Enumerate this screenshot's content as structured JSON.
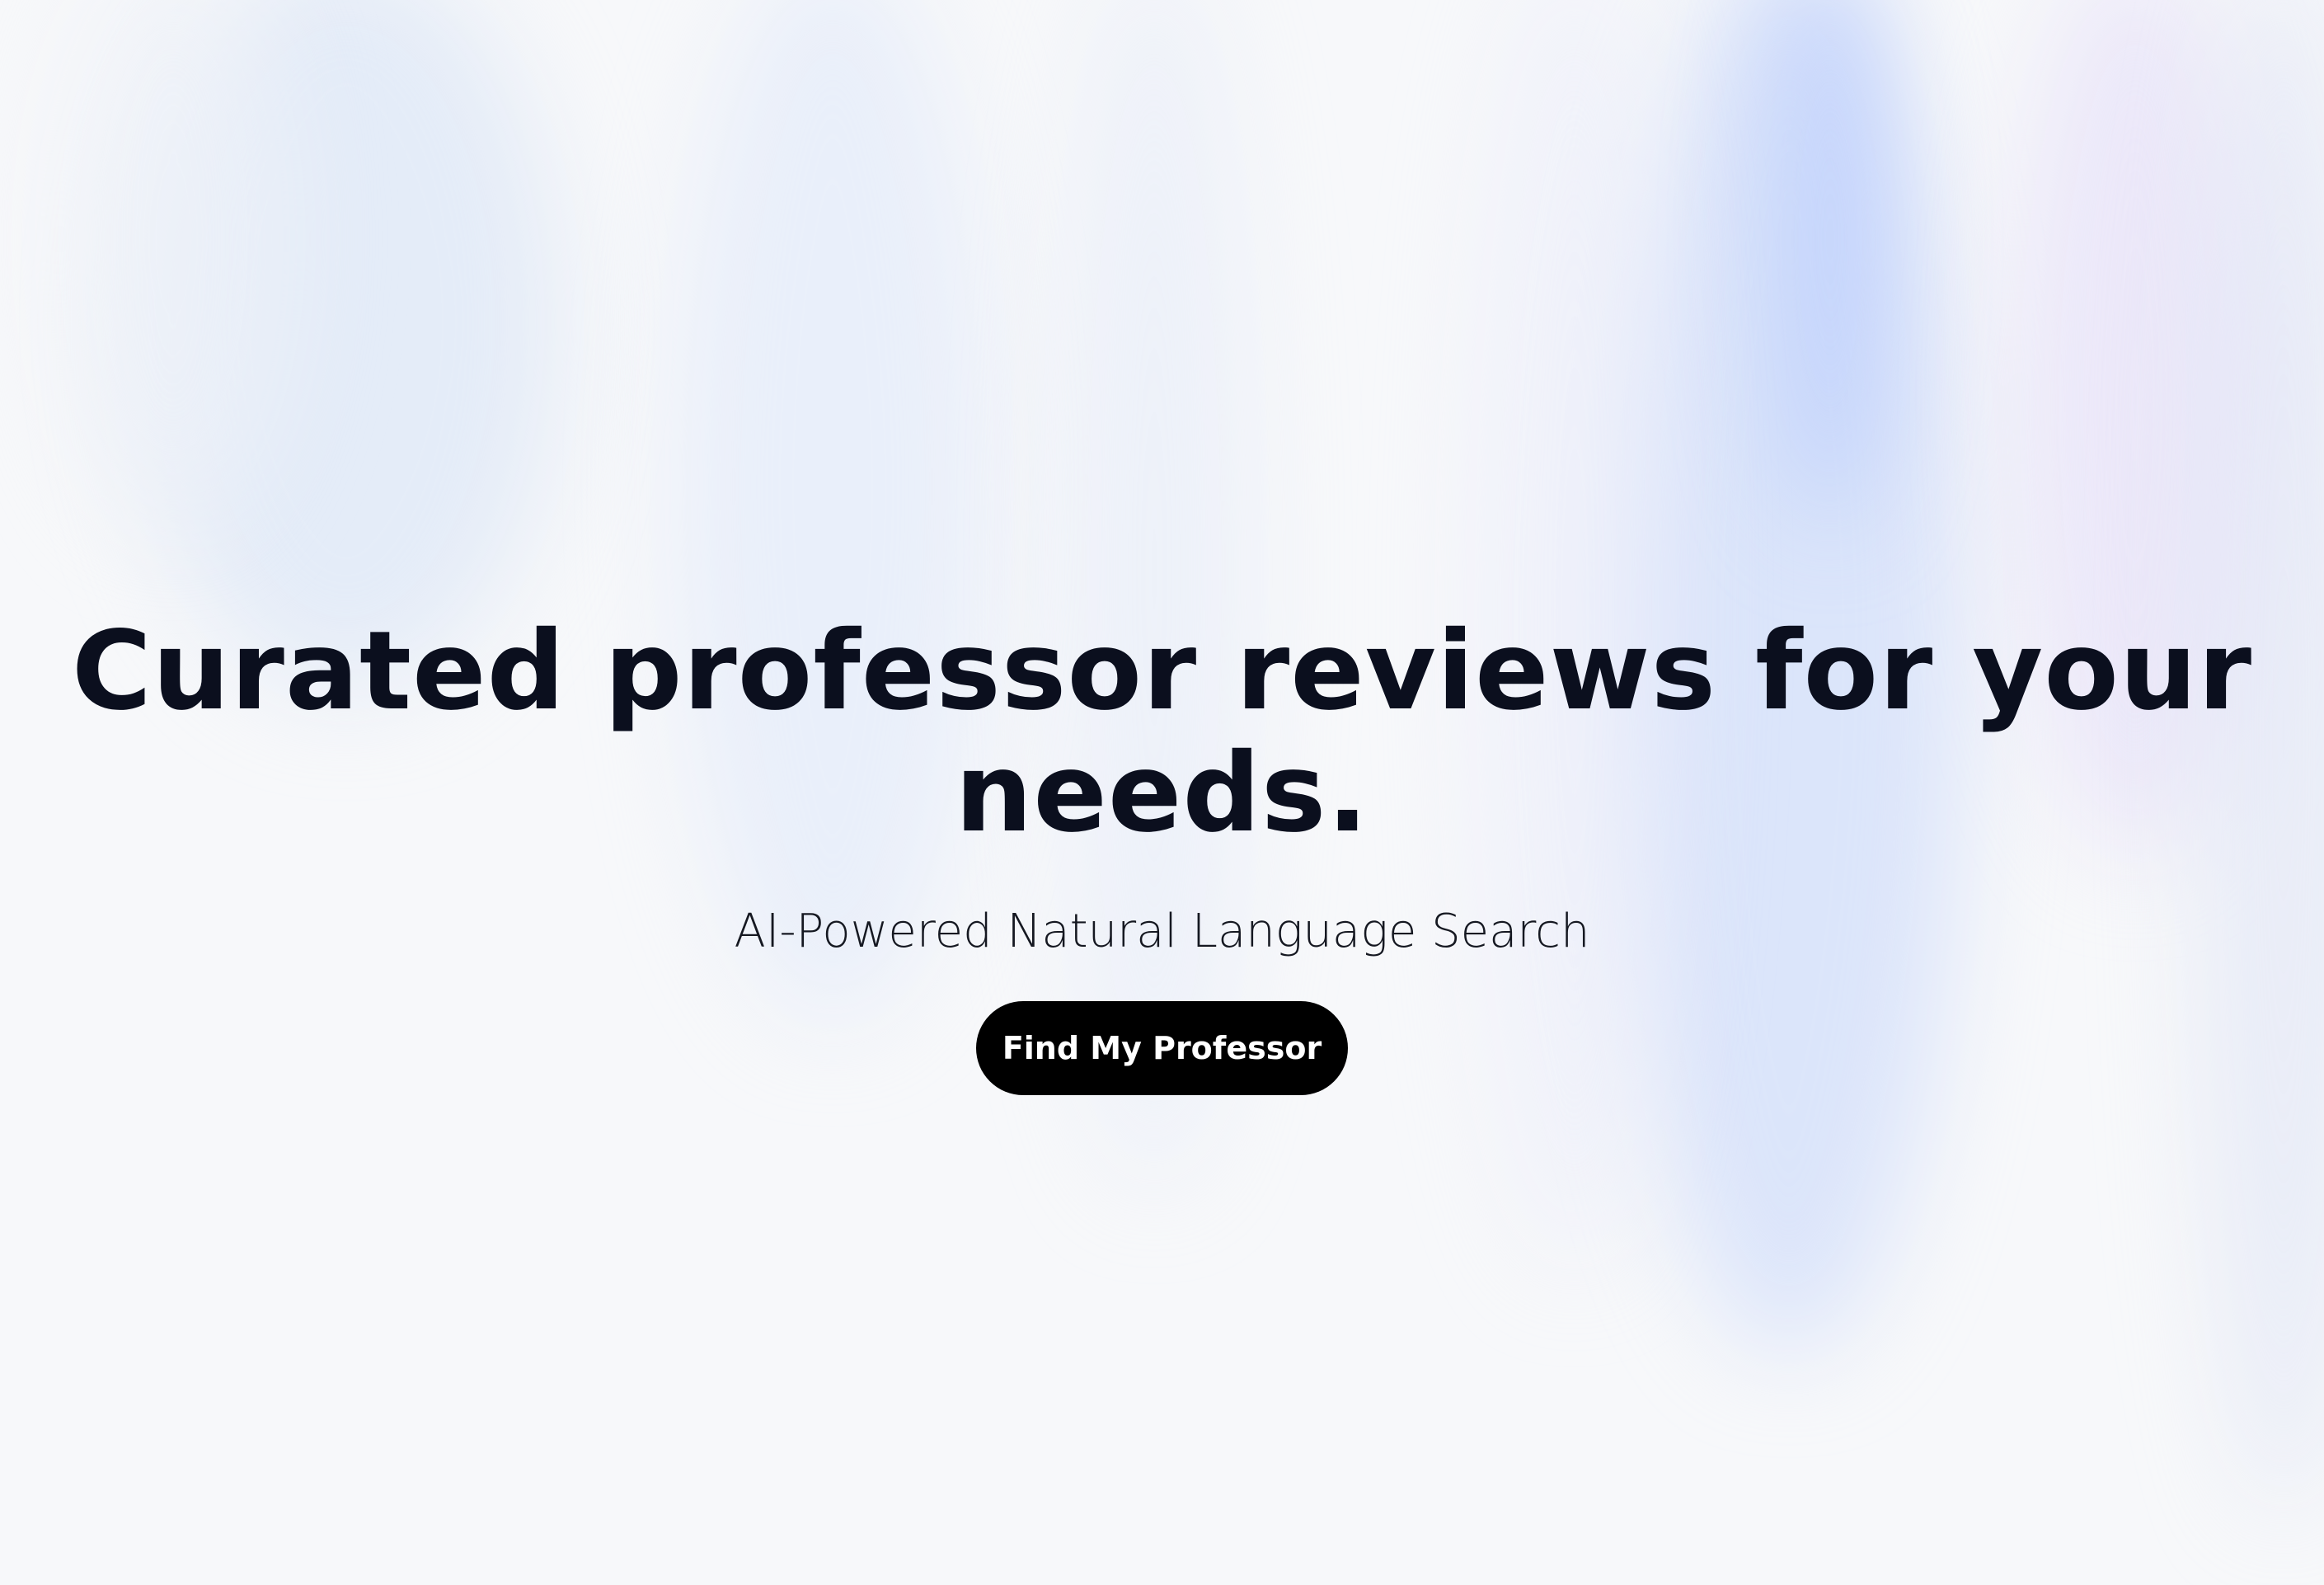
{
  "hero": {
    "title": "Curated professor reviews for your needs.",
    "subtitle": "AI-Powered Natural Language Search",
    "cta_label": "Find My Professor"
  },
  "colors": {
    "background": "#f7f8fa",
    "title_text": "#0b0f1e",
    "cta_background": "#000000",
    "cta_text": "#ffffff"
  }
}
